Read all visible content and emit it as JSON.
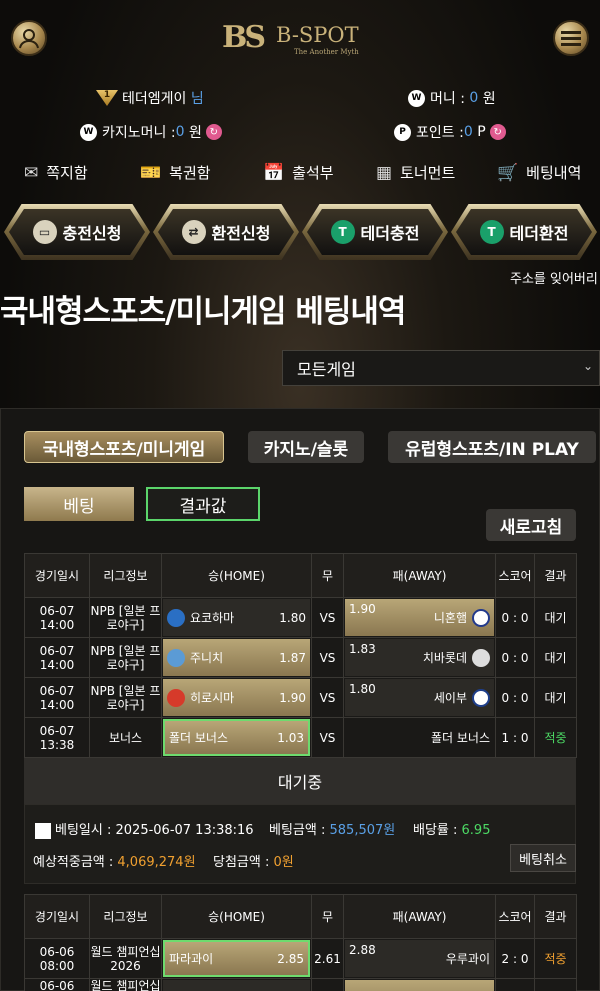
{
  "header": {
    "logo_mark": "BS",
    "logo_name": "B-SPOT",
    "logo_tagline": "The Another Myth",
    "profile_icon": "user-icon",
    "menu_icon": "hamburger-icon"
  },
  "user": {
    "level_badge": "1",
    "username": "테더엠게이",
    "honorific": "님",
    "money_label": "머니 : ",
    "money_value": "0",
    "money_unit": "원",
    "casino_label": "카지노머니 : ",
    "casino_value": "0",
    "casino_unit": "원",
    "point_label": "포인트 : ",
    "point_value": "0",
    "point_unit": "P"
  },
  "nav": [
    {
      "icon": "mail-icon",
      "label": "쪽지함"
    },
    {
      "icon": "ticket-icon",
      "label": "복권함"
    },
    {
      "icon": "calendar-icon",
      "label": "출석부"
    },
    {
      "icon": "tournament-icon",
      "label": "토너먼트"
    },
    {
      "icon": "cart-icon",
      "label": "베팅내역"
    }
  ],
  "actions": [
    {
      "icon": "wallet-icon",
      "label": "충전신청"
    },
    {
      "icon": "exchange-icon",
      "label": "환전신청"
    },
    {
      "icon": "tether-icon",
      "label": "테더충전"
    },
    {
      "icon": "tether-icon",
      "label": "테더환전"
    }
  ],
  "marquee": "주소를 잊어버리",
  "page_title": "국내형스포츠/미니게임 베팅내역",
  "game_select": {
    "value": "모든게임"
  },
  "tabs": [
    "국내형스포츠/미니게임",
    "카지노/슬롯",
    "유럽형스포츠/IN PLAY"
  ],
  "subtabs": [
    "베팅",
    "결과값"
  ],
  "refresh_label": "새로고침",
  "table_headers": [
    "경기일시",
    "리그정보",
    "승(HOME)",
    "무",
    "패(AWAY)",
    "스코어",
    "결과"
  ],
  "slip1": {
    "rows": [
      {
        "date": "06-07",
        "time": "14:00",
        "league1": "NPB [일본 프",
        "league2": "로야구]",
        "home": "요코하마",
        "home_odds": "1.80",
        "draw": "VS",
        "away": "니혼햄",
        "away_odds": "1.90",
        "score": "0 : 0",
        "result": "대기"
      },
      {
        "date": "06-07",
        "time": "14:00",
        "league1": "NPB [일본 프",
        "league2": "로야구]",
        "home": "주니치",
        "home_odds": "1.87",
        "draw": "VS",
        "away": "치바롯데",
        "away_odds": "1.83",
        "score": "0 : 0",
        "result": "대기"
      },
      {
        "date": "06-07",
        "time": "14:00",
        "league1": "NPB [일본 프",
        "league2": "로야구]",
        "home": "히로시마",
        "home_odds": "1.90",
        "draw": "VS",
        "away": "세이부",
        "away_odds": "1.80",
        "score": "0 : 0",
        "result": "대기"
      },
      {
        "date": "06-07",
        "time": "13:38",
        "league1": "보너스",
        "league2": "",
        "home": "폴더 보너스",
        "home_odds": "1.03",
        "draw": "VS",
        "away": "폴더 보너스",
        "away_odds": "",
        "score": "1 : 0",
        "result": "적중"
      }
    ],
    "status": "대기중",
    "bet_time_label": "베팅일시 : ",
    "bet_time": "2025-06-07 13:38:16",
    "bet_amount_label": "베팅금액 : ",
    "bet_amount": "585,507원",
    "odds_label": "배당률 : ",
    "odds": "6.95",
    "expected_label": "예상적중금액 : ",
    "expected": "4,069,274원",
    "win_label": "당첨금액 : ",
    "win": "0원",
    "cancel_label": "베팅취소"
  },
  "slip2": {
    "rows": [
      {
        "date": "06-06",
        "time": "08:00",
        "league1": "월드 챔피언십",
        "league2": "2026",
        "home": "파라과이",
        "home_odds": "2.85",
        "draw": "2.61",
        "away": "우루과이",
        "away_odds": "2.88",
        "score": "2 : 0",
        "result": "적중"
      },
      {
        "date": "06-06",
        "time": "",
        "league1": "월드 챔피언십",
        "league2": "",
        "home": "",
        "home_odds": "",
        "draw": "",
        "away": "",
        "away_odds": "",
        "score": "",
        "result": ""
      }
    ]
  },
  "colors": {
    "gold": "#c9b27a",
    "win": "#4cd964",
    "orange": "#f0a030",
    "blue": "#5aa0e6"
  }
}
